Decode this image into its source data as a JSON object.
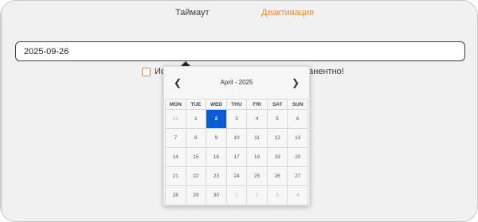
{
  "tabs": [
    {
      "label": "Таймаут"
    },
    {
      "label": "Деактивация"
    }
  ],
  "date_input": {
    "value": "2025-09-26"
  },
  "checkbox": {
    "label_visible_left": "Ис",
    "label_visible_right": "ианентно!",
    "checked": false
  },
  "datepicker": {
    "title": "April - 2025",
    "prev_icon": "chevron-left-icon",
    "next_icon": "chevron-right-icon",
    "weekdays": [
      "MON",
      "TUE",
      "WED",
      "THU",
      "FRI",
      "SAT",
      "SUN"
    ],
    "weeks": [
      [
        {
          "d": "31",
          "out": true
        },
        {
          "d": "1"
        },
        {
          "d": "2",
          "sel": true
        },
        {
          "d": "3"
        },
        {
          "d": "4"
        },
        {
          "d": "5"
        },
        {
          "d": "6"
        }
      ],
      [
        {
          "d": "7"
        },
        {
          "d": "8"
        },
        {
          "d": "9"
        },
        {
          "d": "10"
        },
        {
          "d": "11"
        },
        {
          "d": "12"
        },
        {
          "d": "13"
        }
      ],
      [
        {
          "d": "14"
        },
        {
          "d": "15"
        },
        {
          "d": "16"
        },
        {
          "d": "17"
        },
        {
          "d": "18"
        },
        {
          "d": "19"
        },
        {
          "d": "20"
        }
      ],
      [
        {
          "d": "21"
        },
        {
          "d": "22"
        },
        {
          "d": "23"
        },
        {
          "d": "24"
        },
        {
          "d": "25"
        },
        {
          "d": "26"
        },
        {
          "d": "27"
        }
      ],
      [
        {
          "d": "28"
        },
        {
          "d": "29"
        },
        {
          "d": "30"
        },
        {
          "d": "1",
          "out": true
        },
        {
          "d": "2",
          "out": true
        },
        {
          "d": "3",
          "out": true
        },
        {
          "d": "4",
          "out": true
        }
      ]
    ]
  },
  "colors": {
    "accent": "#f08a24",
    "selected": "#0a5bd6"
  }
}
